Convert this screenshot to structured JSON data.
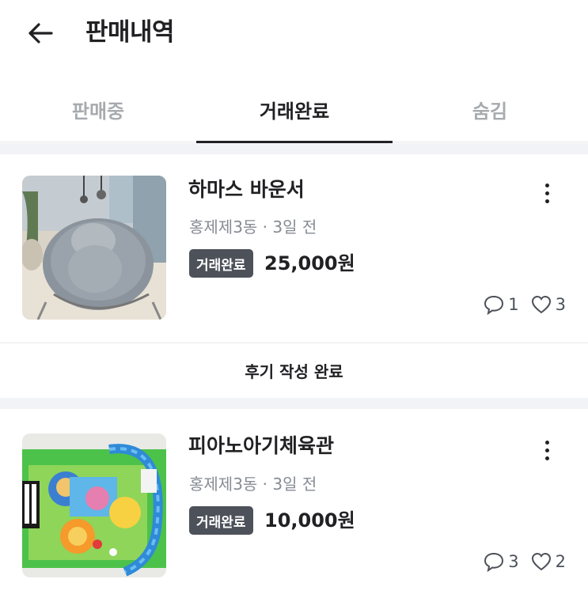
{
  "header": {
    "title": "판매내역",
    "back_icon": "arrow-left-icon"
  },
  "tabs": [
    {
      "label": "판매중",
      "active": false
    },
    {
      "label": "거래완료",
      "active": true
    },
    {
      "label": "숨김",
      "active": false
    }
  ],
  "items": [
    {
      "title": "하마스 바운서",
      "meta": "홍제제3동 · 3일 전",
      "status": "거래완료",
      "price": "25,000원",
      "chats": "1",
      "likes": "3",
      "review": "후기 작성 완료"
    },
    {
      "title": "피아노아기체육관",
      "meta": "홍제제3동 · 3일 전",
      "status": "거래완료",
      "price": "10,000원",
      "chats": "3",
      "likes": "2"
    }
  ],
  "colors": {
    "text": "#212124",
    "muted": "#868b94",
    "badge_bg": "#4d5159",
    "divider_bg": "#f2f3f6"
  }
}
